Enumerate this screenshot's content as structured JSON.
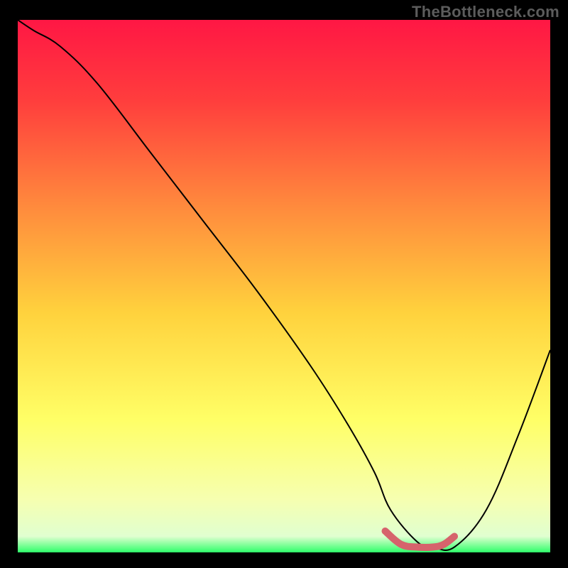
{
  "watermark": "TheBottleneck.com",
  "chart_data": {
    "type": "line",
    "title": "",
    "xlabel": "",
    "ylabel": "",
    "xlim": [
      0,
      100
    ],
    "ylim": [
      0,
      100
    ],
    "grid": false,
    "legend": false,
    "series": [
      {
        "name": "bottleneck-curve",
        "x": [
          0,
          3,
          8,
          15,
          25,
          35,
          45,
          55,
          62,
          67,
          70,
          75,
          78,
          82,
          88,
          94,
          100
        ],
        "y": [
          100,
          98,
          95,
          88,
          75,
          62,
          49,
          35,
          24,
          15,
          8,
          2,
          1,
          1,
          8,
          22,
          38
        ]
      },
      {
        "name": "optimal-band",
        "x": [
          69,
          72,
          75,
          78,
          80,
          82
        ],
        "y": [
          4,
          1.5,
          1,
          1,
          1.5,
          3
        ]
      }
    ],
    "gradient_stops": [
      {
        "offset": 0.0,
        "color": "#ff1744"
      },
      {
        "offset": 0.15,
        "color": "#ff3d3d"
      },
      {
        "offset": 0.35,
        "color": "#ff8a3d"
      },
      {
        "offset": 0.55,
        "color": "#ffd23d"
      },
      {
        "offset": 0.75,
        "color": "#ffff66"
      },
      {
        "offset": 0.9,
        "color": "#f6ffb0"
      },
      {
        "offset": 0.97,
        "color": "#e0ffd0"
      },
      {
        "offset": 1.0,
        "color": "#2eff6a"
      }
    ],
    "curve_color": "#000000",
    "band_color": "#d6636c"
  }
}
